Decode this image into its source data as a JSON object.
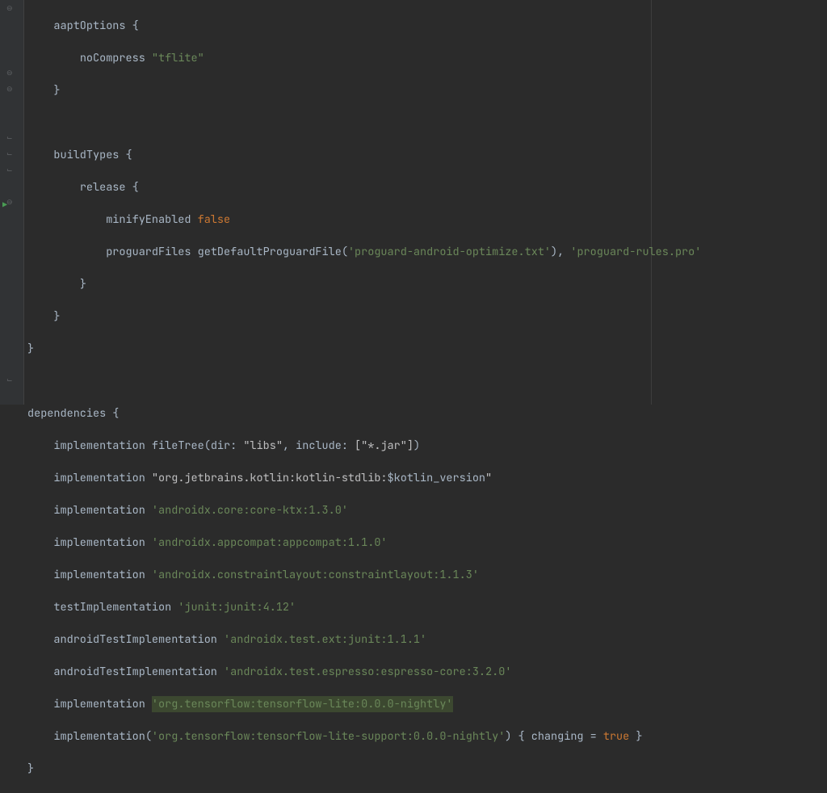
{
  "code": {
    "l1": {
      "name": "aaptOptions",
      "brace": " {"
    },
    "l2": {
      "key": "noCompress",
      "val": "\"tflite\""
    },
    "l3": "}",
    "l4": "",
    "l5": {
      "name": "buildTypes",
      "brace": " {"
    },
    "l6": {
      "name": "release",
      "brace": " {"
    },
    "l7": {
      "key": "minifyEnabled",
      "val": "false"
    },
    "l8": {
      "key": "proguardFiles",
      "call": "getDefaultProguardFile(",
      "arg1": "'proguard-android-optimize.txt'",
      "mid": "), ",
      "arg2": "'proguard-rules.pro'"
    },
    "l9": "}",
    "l10": "}",
    "l11": "}",
    "l12": "",
    "l13": {
      "name": "dependencies",
      "brace": " {"
    },
    "l14": {
      "fn": "implementation",
      "call": "fileTree(",
      "p1k": "dir:",
      "p1v": " \"libs\"",
      "sep": ", ",
      "p2k": "include:",
      "p2v": " [\"*.jar\"]",
      "close": ")"
    },
    "l15": {
      "fn": "implementation",
      "arg_pre": "\"org.jetbrains.kotlin:kotlin-stdlib:",
      "var": "$kotlin_version",
      "arg_post": "\""
    },
    "l16": {
      "fn": "implementation",
      "arg": "'androidx.core:core-ktx:1.3.0'"
    },
    "l17": {
      "fn": "implementation",
      "arg": "'androidx.appcompat:appcompat:1.1.0'"
    },
    "l18": {
      "fn": "implementation",
      "arg": "'androidx.constraintlayout:constraintlayout:1.1.3'"
    },
    "l19": {
      "fn": "testImplementation",
      "arg": "'junit:junit:4.12'"
    },
    "l20": {
      "fn": "androidTestImplementation",
      "arg": "'androidx.test.ext:junit:1.1.1'"
    },
    "l21": {
      "fn": "androidTestImplementation",
      "arg": "'androidx.test.espresso:espresso-core:3.2.0'"
    },
    "l22": {
      "fn": "implementation",
      "arg": "'org.tensorflow:tensorflow-lite:0.0.0-nightly'"
    },
    "l23": {
      "fn": "implementation",
      "open": "(",
      "arg": "'org.tensorflow:tensorflow-lite-support:0.0.0-nightly'",
      "close": ") { ",
      "prop": "changing",
      "eq": " = ",
      "val": "true",
      "end": " }"
    },
    "l24": "}"
  }
}
